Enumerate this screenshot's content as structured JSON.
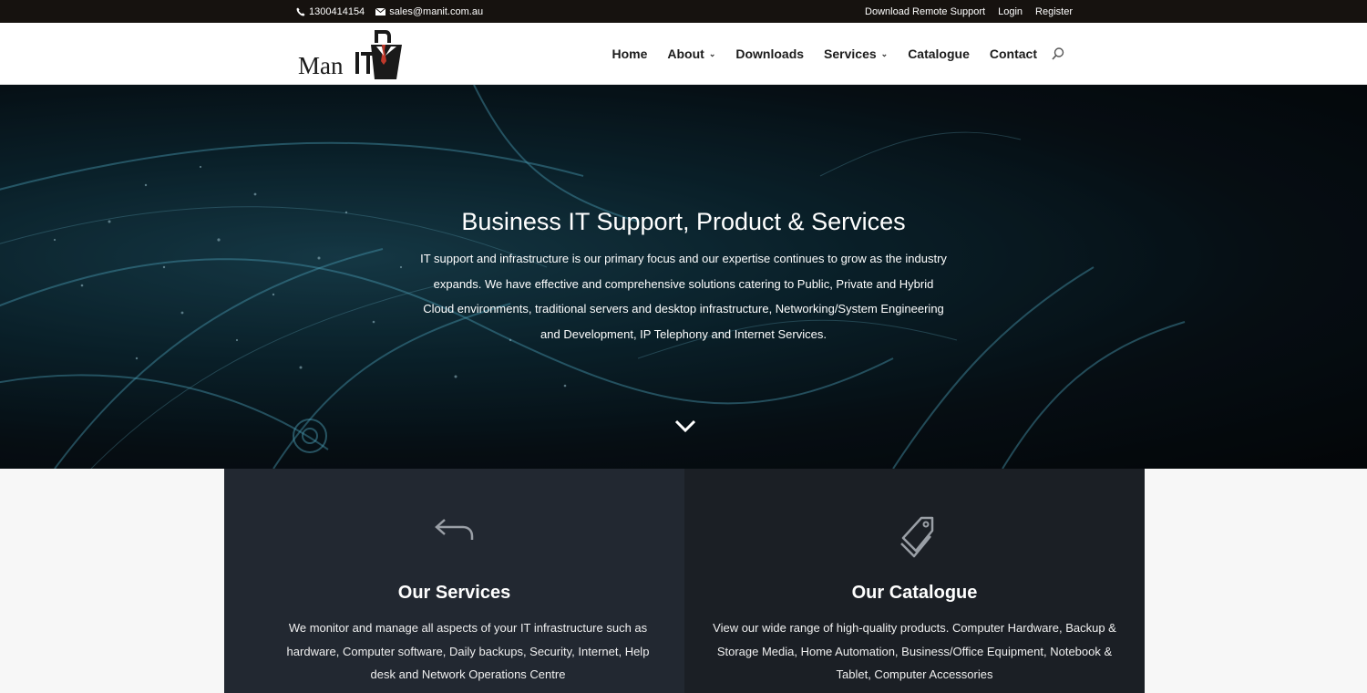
{
  "topbar": {
    "phone": "1300414154",
    "email": "sales@manit.com.au",
    "links": [
      "Download Remote Support",
      "Login",
      "Register"
    ]
  },
  "logo": {
    "text": "Man"
  },
  "nav": {
    "items": [
      {
        "label": "Home"
      },
      {
        "label": "About"
      },
      {
        "label": "Downloads"
      },
      {
        "label": "Services"
      },
      {
        "label": "Catalogue"
      },
      {
        "label": "Contact"
      }
    ]
  },
  "hero": {
    "title": "Business IT Support, Product & Services",
    "text": "IT support and infrastructure is our primary focus and our expertise continues to grow as the industry expands. We have effective and comprehensive solutions catering to Public, Private and Hybrid Cloud environments, traditional servers and desktop infrastructure, Networking/System Engineering and Development, IP Telephony and Internet Services."
  },
  "cards": {
    "services": {
      "title": "Our Services",
      "text": "We monitor and manage all aspects of your IT infrastructure such as hardware, Computer software, Daily backups, Security, Internet, Help desk and Network Operations Centre",
      "icon": "reply-arrow-icon"
    },
    "catalogue": {
      "title": "Our Catalogue",
      "text": "View our wide range of high-quality products. Computer Hardware, Backup & Storage Media, Home Automation, Business/Office Equipment, Notebook & Tablet, Computer Accessories",
      "icon": "tags-icon"
    }
  },
  "colors": {
    "topbar": "#16120f",
    "services_bg": "#222831",
    "catalogue_bg": "#1b1f25",
    "logo_accent": "#c0392b"
  }
}
